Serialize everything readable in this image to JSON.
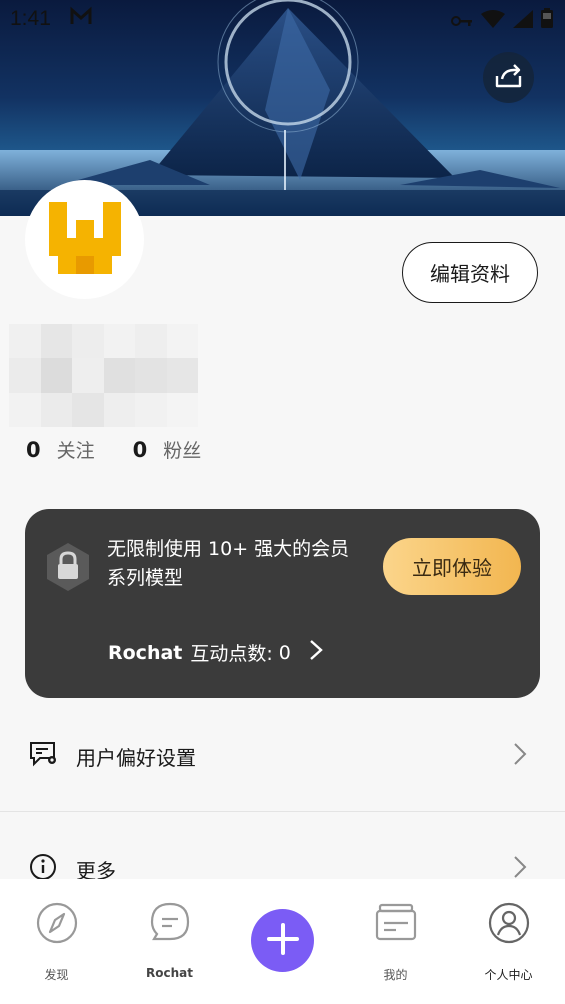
{
  "status_bar": {
    "time": "1:41"
  },
  "profile": {
    "edit_label": "编辑资料",
    "following_count": "0",
    "following_label": "关注",
    "followers_count": "0",
    "followers_label": "粉丝"
  },
  "promo": {
    "text": "无限制使用 10+ 强大的会员系列模型",
    "cta_label": "立即体验",
    "points_brand": "Rochat",
    "points_label": "互动点数:",
    "points_value": "0"
  },
  "menu": [
    {
      "label": "用户偏好设置",
      "icon": "preferences-icon"
    },
    {
      "label": "更多",
      "icon": "info-icon"
    }
  ],
  "tabbar": [
    {
      "label": "发现",
      "icon": "compass-icon"
    },
    {
      "label": "Rochat",
      "icon": "chat-icon"
    },
    {
      "label": "",
      "icon": "plus-icon"
    },
    {
      "label": "我的",
      "icon": "cards-icon"
    },
    {
      "label": "个人中心",
      "icon": "profile-icon"
    }
  ],
  "colors": {
    "accent": "#7b5cf5",
    "cta_start": "#fbd58b",
    "cta_end": "#f2b650",
    "card_bg": "#3b3b3b",
    "avatar_brand": "#f5b301"
  }
}
